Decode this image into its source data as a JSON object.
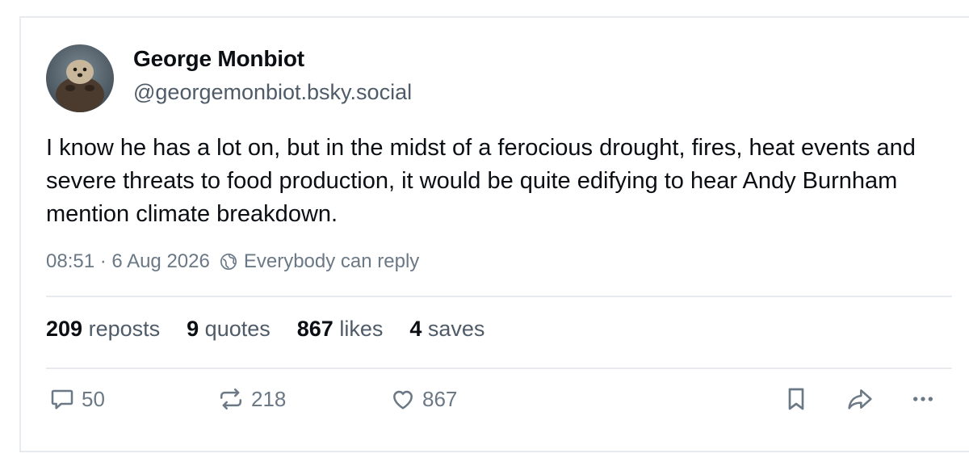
{
  "author": {
    "display_name": "George Monbiot",
    "handle": "@georgemonbiot.bsky.social",
    "avatar_icon": "sea-otter-avatar"
  },
  "post": {
    "text": "I know he has a lot on, but in the midst of a ferocious drought, fires, heat events and severe threats to food production, it would be quite edifying to hear Andy Burnham mention climate breakdown.",
    "timestamp": "08:51 · 6 Aug 2026",
    "reply_setting": "Everybody can reply"
  },
  "stats": [
    {
      "count": "209",
      "label": "reposts"
    },
    {
      "count": "9",
      "label": "quotes"
    },
    {
      "count": "867",
      "label": "likes"
    },
    {
      "count": "4",
      "label": "saves"
    }
  ],
  "actions": {
    "reply_count": "50",
    "repost_count": "218",
    "like_count": "867"
  },
  "colors": {
    "text": "#0b0f14",
    "muted": "#6b7886",
    "divider": "#e7ebef"
  }
}
